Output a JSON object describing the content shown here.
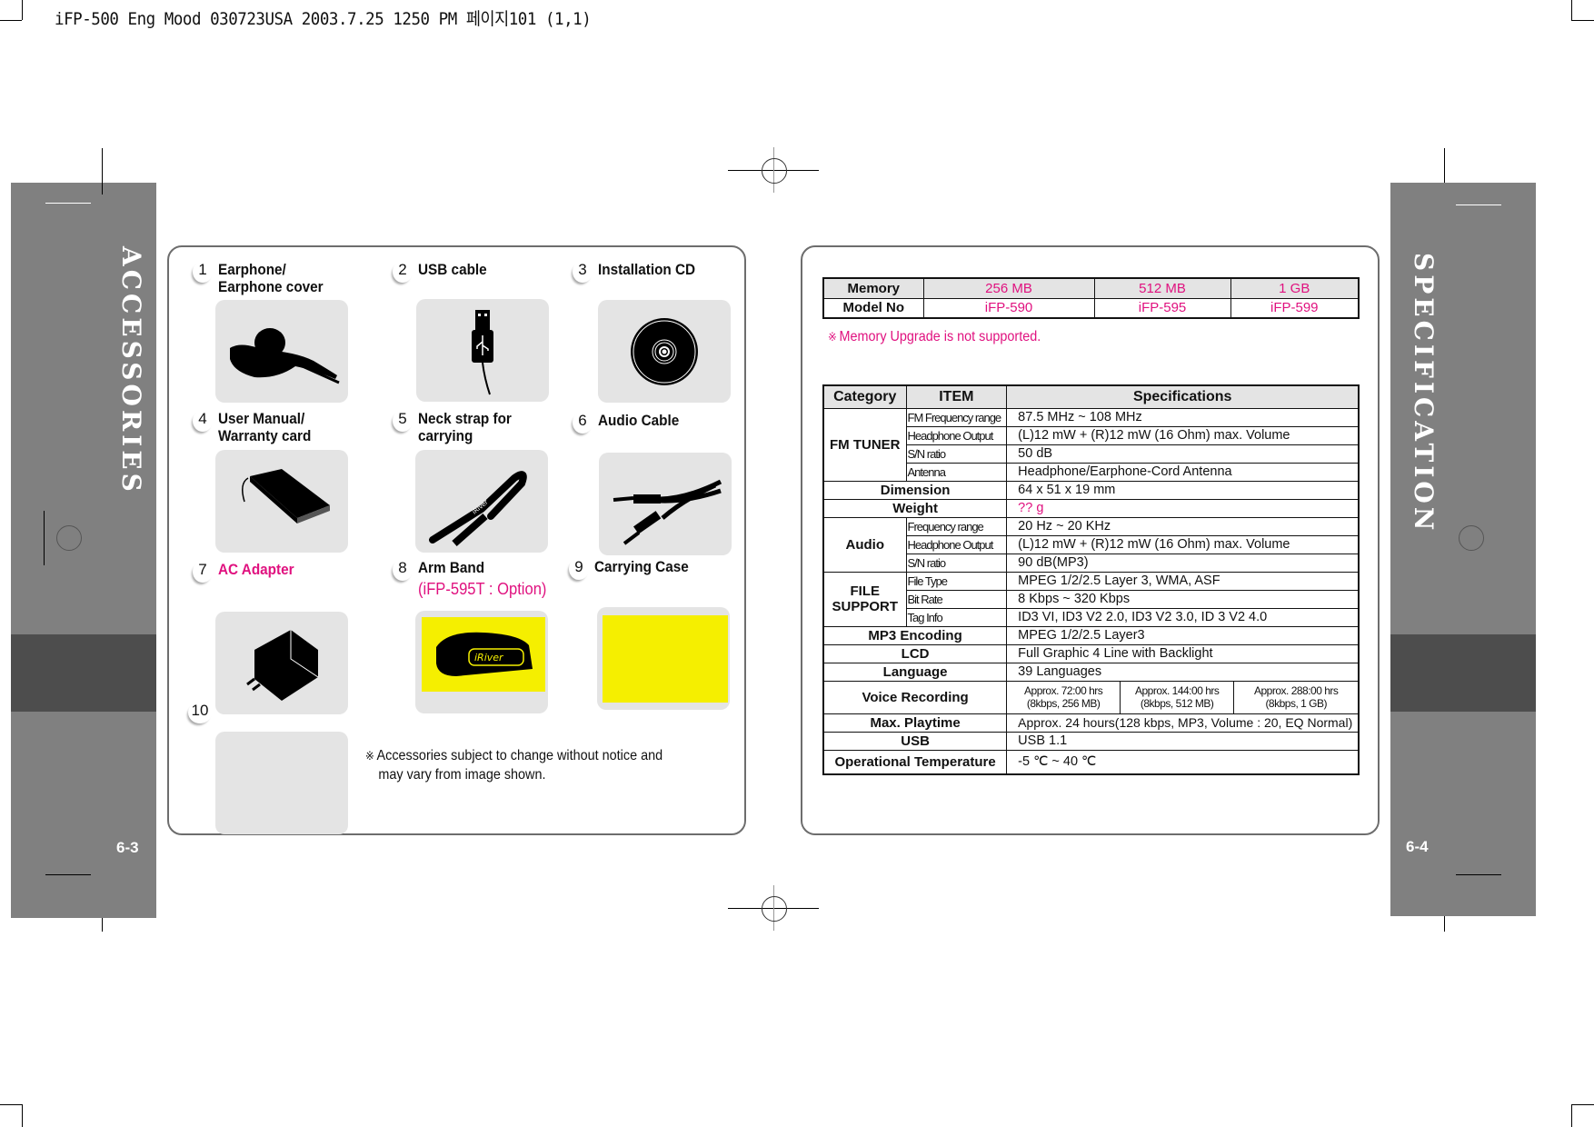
{
  "header": {
    "print_info": "iFP-500 Eng Mood 030723USA  2003.7.25 1250 PM 페이지101 (1,1)"
  },
  "left_page": {
    "side_title": "ACCESSORIES",
    "page_number": "6-3",
    "accessories": [
      {
        "num": "1",
        "title": "Earphone/",
        "title2": "Earphone cover",
        "icon": "earphone-icon",
        "highlight": false
      },
      {
        "num": "2",
        "title": "USB cable",
        "title2": "",
        "icon": "usb-cable-icon",
        "highlight": false
      },
      {
        "num": "3",
        "title": "Installation CD",
        "title2": "",
        "icon": "cd-icon",
        "highlight": false
      },
      {
        "num": "4",
        "title": "User Manual/",
        "title2": "Warranty card",
        "icon": "manual-icon",
        "highlight": false
      },
      {
        "num": "5",
        "title": "Neck strap for",
        "title2": "carrying",
        "icon": "neck-strap-icon",
        "highlight": false
      },
      {
        "num": "6",
        "title": "Audio Cable",
        "title2": "",
        "icon": "audio-cable-icon",
        "highlight": false
      },
      {
        "num": "7",
        "title": "AC Adapter",
        "title2": "",
        "icon": "ac-adapter-icon",
        "highlight": true
      },
      {
        "num": "8",
        "title": "Arm Band",
        "title2": "(iFP-595T : Option)",
        "icon": "arm-band-icon",
        "highlight": false
      },
      {
        "num": "9",
        "title": "Carrying Case",
        "title2": "",
        "icon": "carrying-case-icon",
        "highlight": false
      },
      {
        "num": "10",
        "title": "",
        "title2": "",
        "icon": "blank-image",
        "highlight": false
      }
    ],
    "note_mark": "※",
    "note_line1": "Accessories subject to change without notice and",
    "note_line2": "may vary from image shown."
  },
  "right_page": {
    "side_title": "SPECIFICATION",
    "page_number": "6-4",
    "memory_table": {
      "row1_label": "Memory",
      "row2_label": "Model No",
      "memory": [
        "256 MB",
        "512 MB",
        "1 GB"
      ],
      "models": [
        "iFP-590",
        "iFP-595",
        "iFP-599"
      ]
    },
    "memory_note_mark": "※",
    "memory_note": "Memory Upgrade is not supported.",
    "spec_table": {
      "headers": [
        "Category",
        "ITEM",
        "Specifications"
      ],
      "fm_tuner": {
        "category": "FM TUNER",
        "rows": [
          {
            "item": "FM Frequency range",
            "value": "87.5 MHz ~ 108 MHz"
          },
          {
            "item": "Headphone Output",
            "value": "(L)12 mW + (R)12 mW (16 Ohm) max. Volume"
          },
          {
            "item": "S/N ratio",
            "value": "50 dB"
          },
          {
            "item": "Antenna",
            "value": "Headphone/Earphone-Cord Antenna"
          }
        ]
      },
      "dimension": {
        "label": "Dimension",
        "value": "64 x 51 x 19 mm"
      },
      "weight": {
        "label": "Weight",
        "value": "?? g"
      },
      "audio": {
        "category": "Audio",
        "rows": [
          {
            "item": "Frequency range",
            "value": "20 Hz ~ 20 KHz"
          },
          {
            "item": "Headphone Output",
            "value": "(L)12 mW + (R)12 mW (16 Ohm) max. Volume"
          },
          {
            "item": "S/N ratio",
            "value": "90 dB(MP3)"
          }
        ]
      },
      "file_support": {
        "category_line1": "FILE",
        "category_line2": "SUPPORT",
        "rows": [
          {
            "item": "File Type",
            "value": "MPEG 1/2/2.5 Layer 3, WMA, ASF"
          },
          {
            "item": "Bit Rate",
            "value": "8 Kbps ~ 320 Kbps"
          },
          {
            "item": "Tag Info",
            "value": "ID3 VI, ID3 V2 2.0, ID3 V2 3.0, ID 3 V2 4.0"
          }
        ]
      },
      "mp3_encoding": {
        "label": "MP3 Encoding",
        "value": "MPEG 1/2/2.5 Layer3"
      },
      "lcd": {
        "label": "LCD",
        "value": "Full Graphic 4 Line with Backlight"
      },
      "language": {
        "label": "Language",
        "value": "39 Languages"
      },
      "voice_recording": {
        "label": "Voice Recording",
        "values": [
          {
            "line1": "Approx. 72:00 hrs",
            "line2": "(8kbps, 256 MB)"
          },
          {
            "line1": "Approx. 144:00 hrs",
            "line2": "(8kbps, 512 MB)"
          },
          {
            "line1": "Approx. 288:00 hrs",
            "line2": "(8kbps, 1 GB)"
          }
        ]
      },
      "max_playtime": {
        "label": "Max. Playtime",
        "value": "Approx. 24 hours(128 kbps, MP3, Volume : 20, EQ Normal)"
      },
      "usb": {
        "label": "USB",
        "value": "USB 1.1"
      },
      "operational_temperature": {
        "label": "Operational Temperature",
        "value": "-5 ℃ ~  40 ℃"
      }
    }
  },
  "colors": {
    "accent_pink": "#e0117f",
    "side_bar_gray": "#808080",
    "side_band_dark": "#4d4d4d",
    "image_box_gray": "#e4e4e4",
    "highlight_yellow": "#f5ef00"
  }
}
